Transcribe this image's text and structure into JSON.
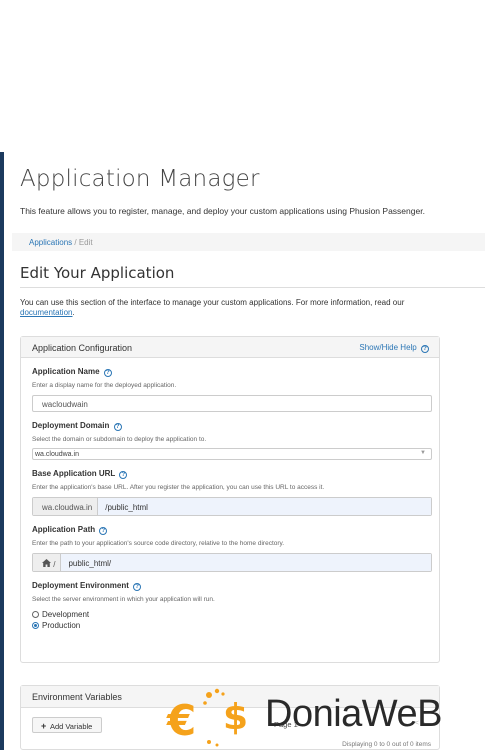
{
  "header": {
    "title": "Application Manager",
    "description": "This feature allows you to register, manage, and deploy your custom applications using Phusion Passenger."
  },
  "breadcrumb": {
    "link": "Applications",
    "separator": "/",
    "current": "Edit"
  },
  "edit": {
    "title": "Edit Your Application",
    "description": "You can use this section of the interface to manage your custom applications. For more information, read our",
    "link": "documentation",
    "after_link": "."
  },
  "config_panel": {
    "title": "Application Configuration",
    "help_link": "Show/Hide Help",
    "help_icon": "question-circle-icon",
    "app_name": {
      "label": "Application Name",
      "hint": "Enter a display name for the deployed application.",
      "value": "wacloudwain"
    },
    "domain": {
      "label": "Deployment Domain",
      "hint": "Select the domain or subdomain to deploy the application to.",
      "value": "wa.cloudwa.in",
      "arrow": "▼"
    },
    "base_url": {
      "label": "Base Application URL",
      "hint": "Enter the application's base URL. After you register the application, you can use this URL to access it.",
      "prefix": "wa.cloudwa.in",
      "value": "/public_html"
    },
    "path": {
      "label": "Application Path",
      "hint": "Enter the path to your application's source code directory, relative to the home directory.",
      "prefix_icon": "home-icon",
      "prefix_text": "/",
      "value": "public_html/"
    },
    "environment": {
      "label": "Deployment Environment",
      "hint": "Select the server environment in which your application will run.",
      "options": [
        "Development",
        "Production"
      ],
      "selected": "Production"
    }
  },
  "env_panel": {
    "title": "Environment Variables",
    "add_button": "Add Variable",
    "pager_label": "Page",
    "pager_value": "1",
    "pager_nav": "< >",
    "displaying": "Displaying 0 to 0 out of 0 items"
  },
  "watermark": {
    "text": "DoniaWeB",
    "colors": {
      "orange": "#f5a21b",
      "dark": "#2a2a2a"
    }
  },
  "colors": {
    "link": "#2b76b5",
    "sidebar": "#1c3a5e",
    "panel_header": "#f5f5f5",
    "input_fill": "#eef3fc"
  }
}
